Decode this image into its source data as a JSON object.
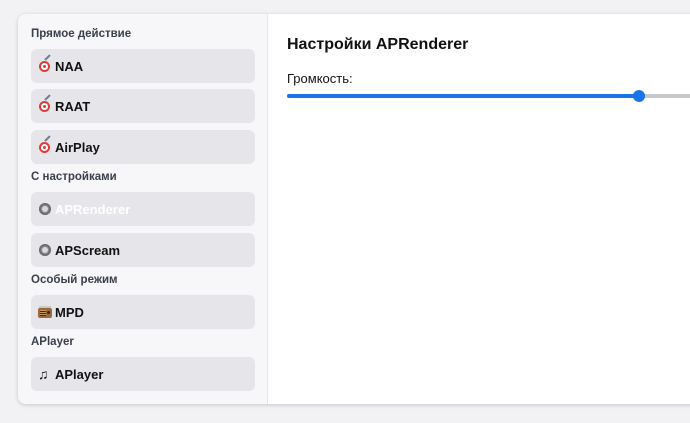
{
  "sidebar": {
    "groups": [
      {
        "label": "Прямое действие",
        "items": [
          {
            "label": "NAA",
            "icon": "target-icon"
          },
          {
            "label": "RAAT",
            "icon": "target-icon"
          },
          {
            "label": "AirPlay",
            "icon": "target-icon"
          }
        ]
      },
      {
        "label": "С настройками",
        "items": [
          {
            "label": "APRenderer",
            "icon": "gear-icon",
            "active": true
          },
          {
            "label": "APScream",
            "icon": "gear-icon"
          }
        ]
      },
      {
        "label": "Особый режим",
        "items": [
          {
            "label": "MPD",
            "icon": "radio-icon"
          }
        ]
      },
      {
        "label": "APlayer",
        "items": [
          {
            "label": "APlayer",
            "icon": "music-note-icon"
          }
        ]
      }
    ]
  },
  "main": {
    "title": "Настройки APRenderer",
    "volume": {
      "label": "Громкость:",
      "value": 0.8
    }
  },
  "colors": {
    "accent": "#1a73e8",
    "item_bg": "#e6e6ea",
    "sidebar_bg": "#f7f7f9"
  }
}
